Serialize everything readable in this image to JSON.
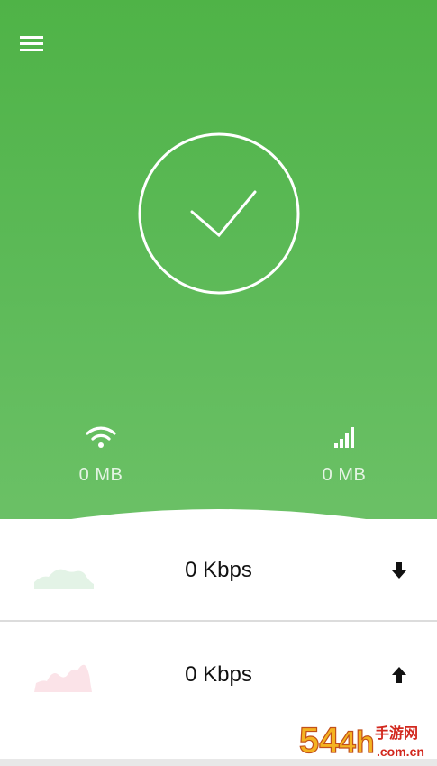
{
  "header": {
    "menu_icon": "hamburger-menu-icon"
  },
  "status": {
    "icon": "checkmark-circle-icon",
    "color": "#ffffff"
  },
  "usage": {
    "wifi": {
      "icon": "wifi-icon",
      "value": "0 MB"
    },
    "mobile": {
      "icon": "cellular-signal-icon",
      "value": "0 MB"
    }
  },
  "speed": {
    "download": {
      "value": "0 Kbps",
      "icon": "arrow-down-icon",
      "graph_color": "#e3f3e6"
    },
    "upload": {
      "value": "0 Kbps",
      "icon": "arrow-up-icon",
      "graph_color": "#fbe3e8"
    }
  },
  "theme": {
    "primary": "#4fb347",
    "background": "#ffffff",
    "text": "#111111"
  },
  "watermark": {
    "logo_text": "54⁴h手游网",
    "domain_text": ".com.cn"
  }
}
